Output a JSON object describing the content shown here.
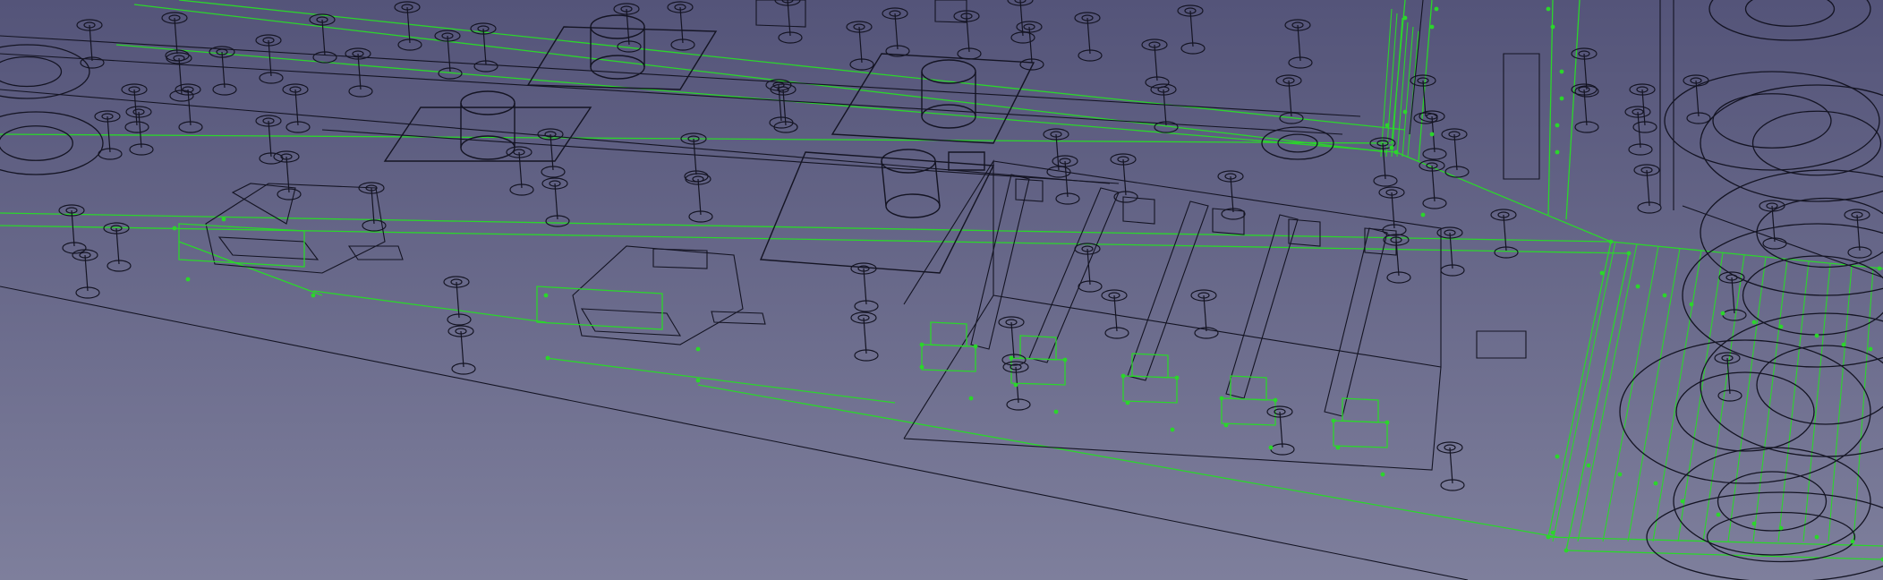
{
  "viewport": {
    "kind": "3d-cad-wireframe-view",
    "background_top": "#545479",
    "background_bottom": "#7e7f9c",
    "edge_color": "#141423",
    "selection_color": "#2bd62b",
    "vertex_color": "#2bd62b"
  }
}
